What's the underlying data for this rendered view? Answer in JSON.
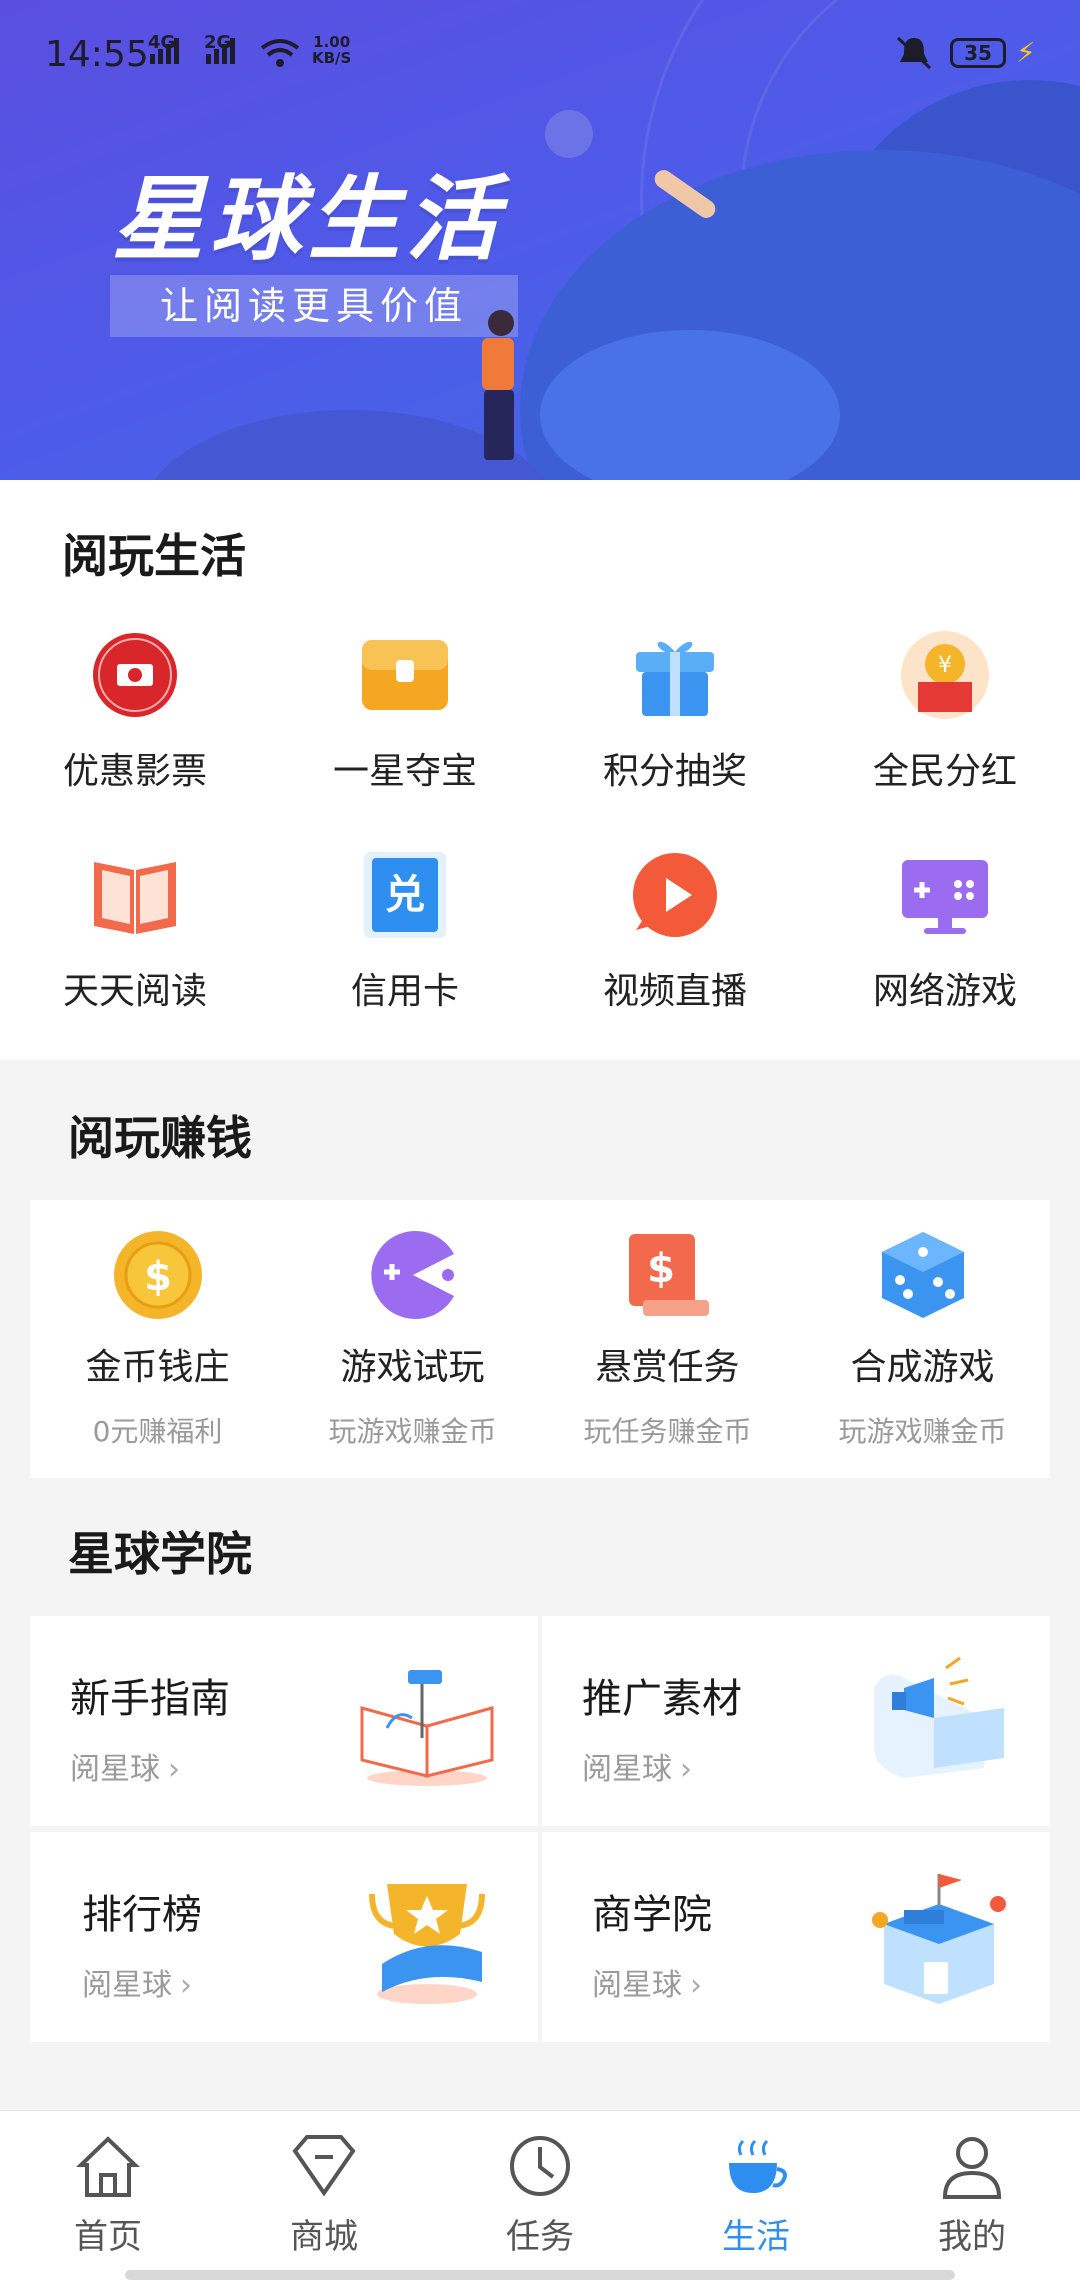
{
  "status_bar": {
    "time": "14:55",
    "net1": "4G",
    "net2": "2G",
    "speed_value": "1.00",
    "speed_unit": "KB/S",
    "battery": "35"
  },
  "banner": {
    "title": "星球生活",
    "subtitle": "让阅读更具价值"
  },
  "life_section": {
    "title": "阅玩生活",
    "items": [
      {
        "label": "优惠影票",
        "icon": "ticket-icon"
      },
      {
        "label": "一星夺宝",
        "icon": "treasure-chest-icon"
      },
      {
        "label": "积分抽奖",
        "icon": "gift-icon"
      },
      {
        "label": "全民分红",
        "icon": "red-envelope-icon"
      },
      {
        "label": "天天阅读",
        "icon": "open-book-icon"
      },
      {
        "label": "信用卡",
        "icon": "redeem-card-icon"
      },
      {
        "label": "视频直播",
        "icon": "play-icon"
      },
      {
        "label": "网络游戏",
        "icon": "game-screen-icon"
      }
    ]
  },
  "earn_section": {
    "title": "阅玩赚钱",
    "items": [
      {
        "label": "金币钱庄",
        "sub": "0元赚福利",
        "icon": "coin-icon"
      },
      {
        "label": "游戏试玩",
        "sub": "玩游戏赚金币",
        "icon": "pacman-icon"
      },
      {
        "label": "悬赏任务",
        "sub": "玩任务赚金币",
        "icon": "reward-book-icon"
      },
      {
        "label": "合成游戏",
        "sub": "玩游戏赚金币",
        "icon": "dice-icon"
      }
    ]
  },
  "academy_section": {
    "title": "星球学院",
    "cards": [
      {
        "title": "新手指南",
        "sub": "阅星球",
        "icon": "guide-book-icon"
      },
      {
        "title": "推广素材",
        "sub": "阅星球",
        "icon": "megaphone-icon"
      },
      {
        "title": "排行榜",
        "sub": "阅星球",
        "icon": "trophy-icon"
      },
      {
        "title": "商学院",
        "sub": "阅星球",
        "icon": "school-building-icon"
      }
    ]
  },
  "tabbar": {
    "items": [
      {
        "label": "首页",
        "icon": "home-icon",
        "active": false
      },
      {
        "label": "商城",
        "icon": "diamond-icon",
        "active": false
      },
      {
        "label": "任务",
        "icon": "clock-icon",
        "active": false
      },
      {
        "label": "生活",
        "icon": "coffee-cup-icon",
        "active": true
      },
      {
        "label": "我的",
        "icon": "person-icon",
        "active": false
      }
    ]
  },
  "colors": {
    "accent": "#2f8ff0",
    "banner": "#5a4ee0"
  }
}
